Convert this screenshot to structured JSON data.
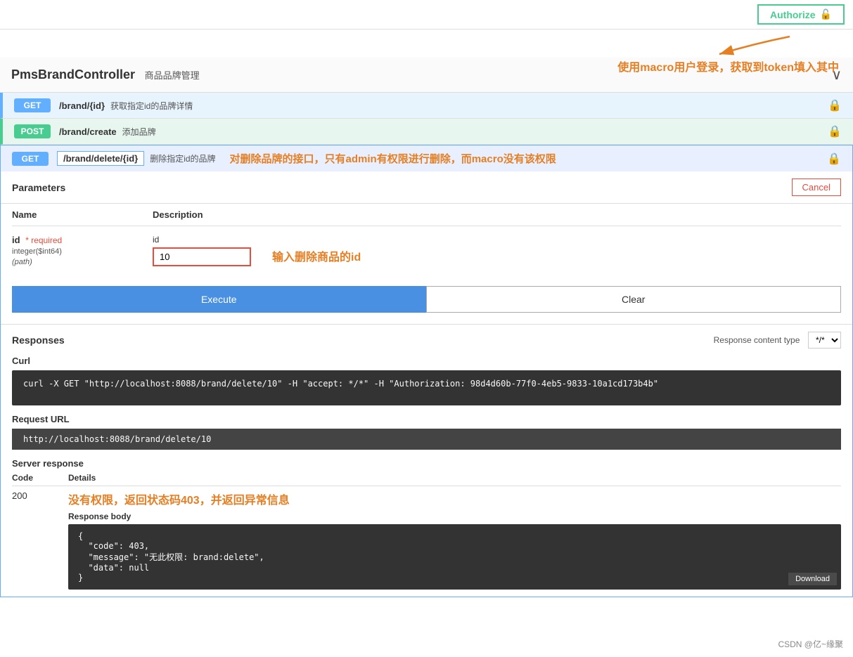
{
  "topBar": {
    "authorizeLabel": "Authorize",
    "lockIcon": "🔒"
  },
  "topAnnotation": {
    "arrowText": "↖",
    "text": "使用macro用户登录，获取到token填入其中"
  },
  "controller": {
    "title": "PmsBrandController",
    "subtitle": "商品品牌管理",
    "collapseIcon": "∨"
  },
  "apis": [
    {
      "method": "GET",
      "path": "/brand/{id}",
      "desc": "获取指定id的品牌详情",
      "type": "get"
    },
    {
      "method": "POST",
      "path": "/brand/create",
      "desc": "添加品牌",
      "type": "post"
    },
    {
      "method": "GET",
      "path": "/brand/delete/{id}",
      "desc": "删除指定id的品牌",
      "type": "get-active"
    }
  ],
  "deleteAnnotation": "对删除品牌的接口，只有admin有权限进行删除，而macro没有该权限",
  "expandedPanel": {
    "title": "Parameters",
    "cancelLabel": "Cancel",
    "colNameLabel": "Name",
    "colDescLabel": "Description",
    "param": {
      "name": "id",
      "required": "* required",
      "type": "integer($int64)",
      "location": "(path)",
      "inputLabel": "id",
      "inputAnnotation": "输入删除商品的id",
      "inputValue": "10"
    },
    "executeLabel": "Execute",
    "clearLabel": "Clear"
  },
  "responses": {
    "title": "Responses",
    "contentTypeLabel": "Response content type",
    "contentTypeValue": "*/*",
    "curlTitle": "Curl",
    "curlValue": "curl -X GET \"http://localhost:8088/brand/delete/10\" -H \"accept: */*\" -H \"Authorization: 98d4d60b-77f0-4eb5-9833-10a1cd173b4b\"",
    "requestUrlTitle": "Request URL",
    "requestUrlValue": "http://localhost:8088/brand/delete/10",
    "serverResponseTitle": "Server response",
    "codeLabel": "Code",
    "detailsLabel": "Details",
    "responseCode": "200",
    "responseBodyTitle": "Response body",
    "responseBodyAnnotation": "没有权限，返回状态码403，并返回异常信息",
    "responseBody": "{\n  \"code\": 403,\n  \"message\": \"无此权限: brand:delete\",\n  \"data\": null\n}",
    "downloadLabel": "Download"
  },
  "watermark": "CSDN @亿~缘聚"
}
